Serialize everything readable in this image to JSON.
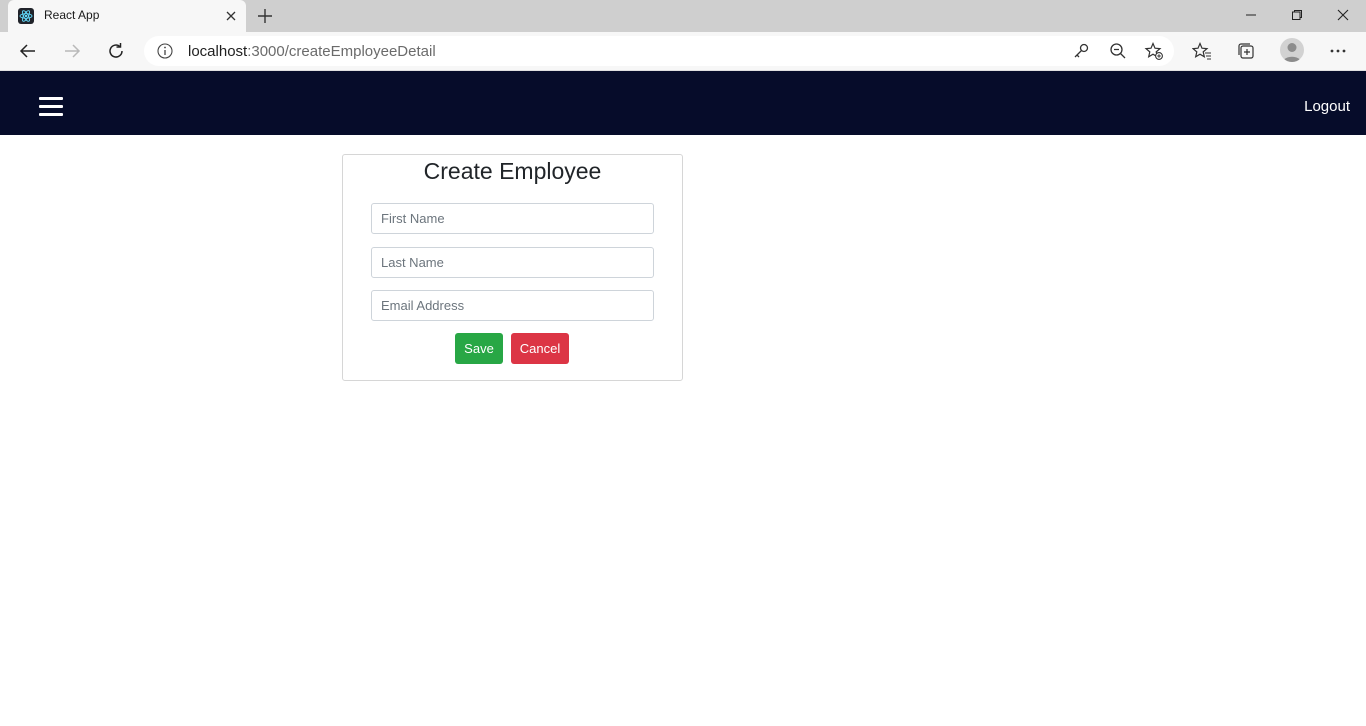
{
  "browser": {
    "tab_title": "React App",
    "address_host": "localhost",
    "address_path": ":3000/createEmployeeDetail"
  },
  "nav": {
    "logout_label": "Logout"
  },
  "form": {
    "title": "Create Employee",
    "first_name": {
      "placeholder": "First Name",
      "value": ""
    },
    "last_name": {
      "placeholder": "Last Name",
      "value": ""
    },
    "email": {
      "placeholder": "Email Address",
      "value": ""
    },
    "save_label": "Save",
    "cancel_label": "Cancel"
  },
  "colors": {
    "nav_bg": "#060c2a",
    "save": "#28a745",
    "cancel": "#dc3545"
  },
  "icons": [
    "react-icon",
    "close-icon",
    "plus-icon",
    "back-icon",
    "forward-icon",
    "refresh-icon",
    "info-icon",
    "key-icon",
    "zoom-out-icon",
    "add-favorite-icon",
    "favorites-icon",
    "collections-icon",
    "profile-icon",
    "more-icon",
    "menu-icon"
  ]
}
